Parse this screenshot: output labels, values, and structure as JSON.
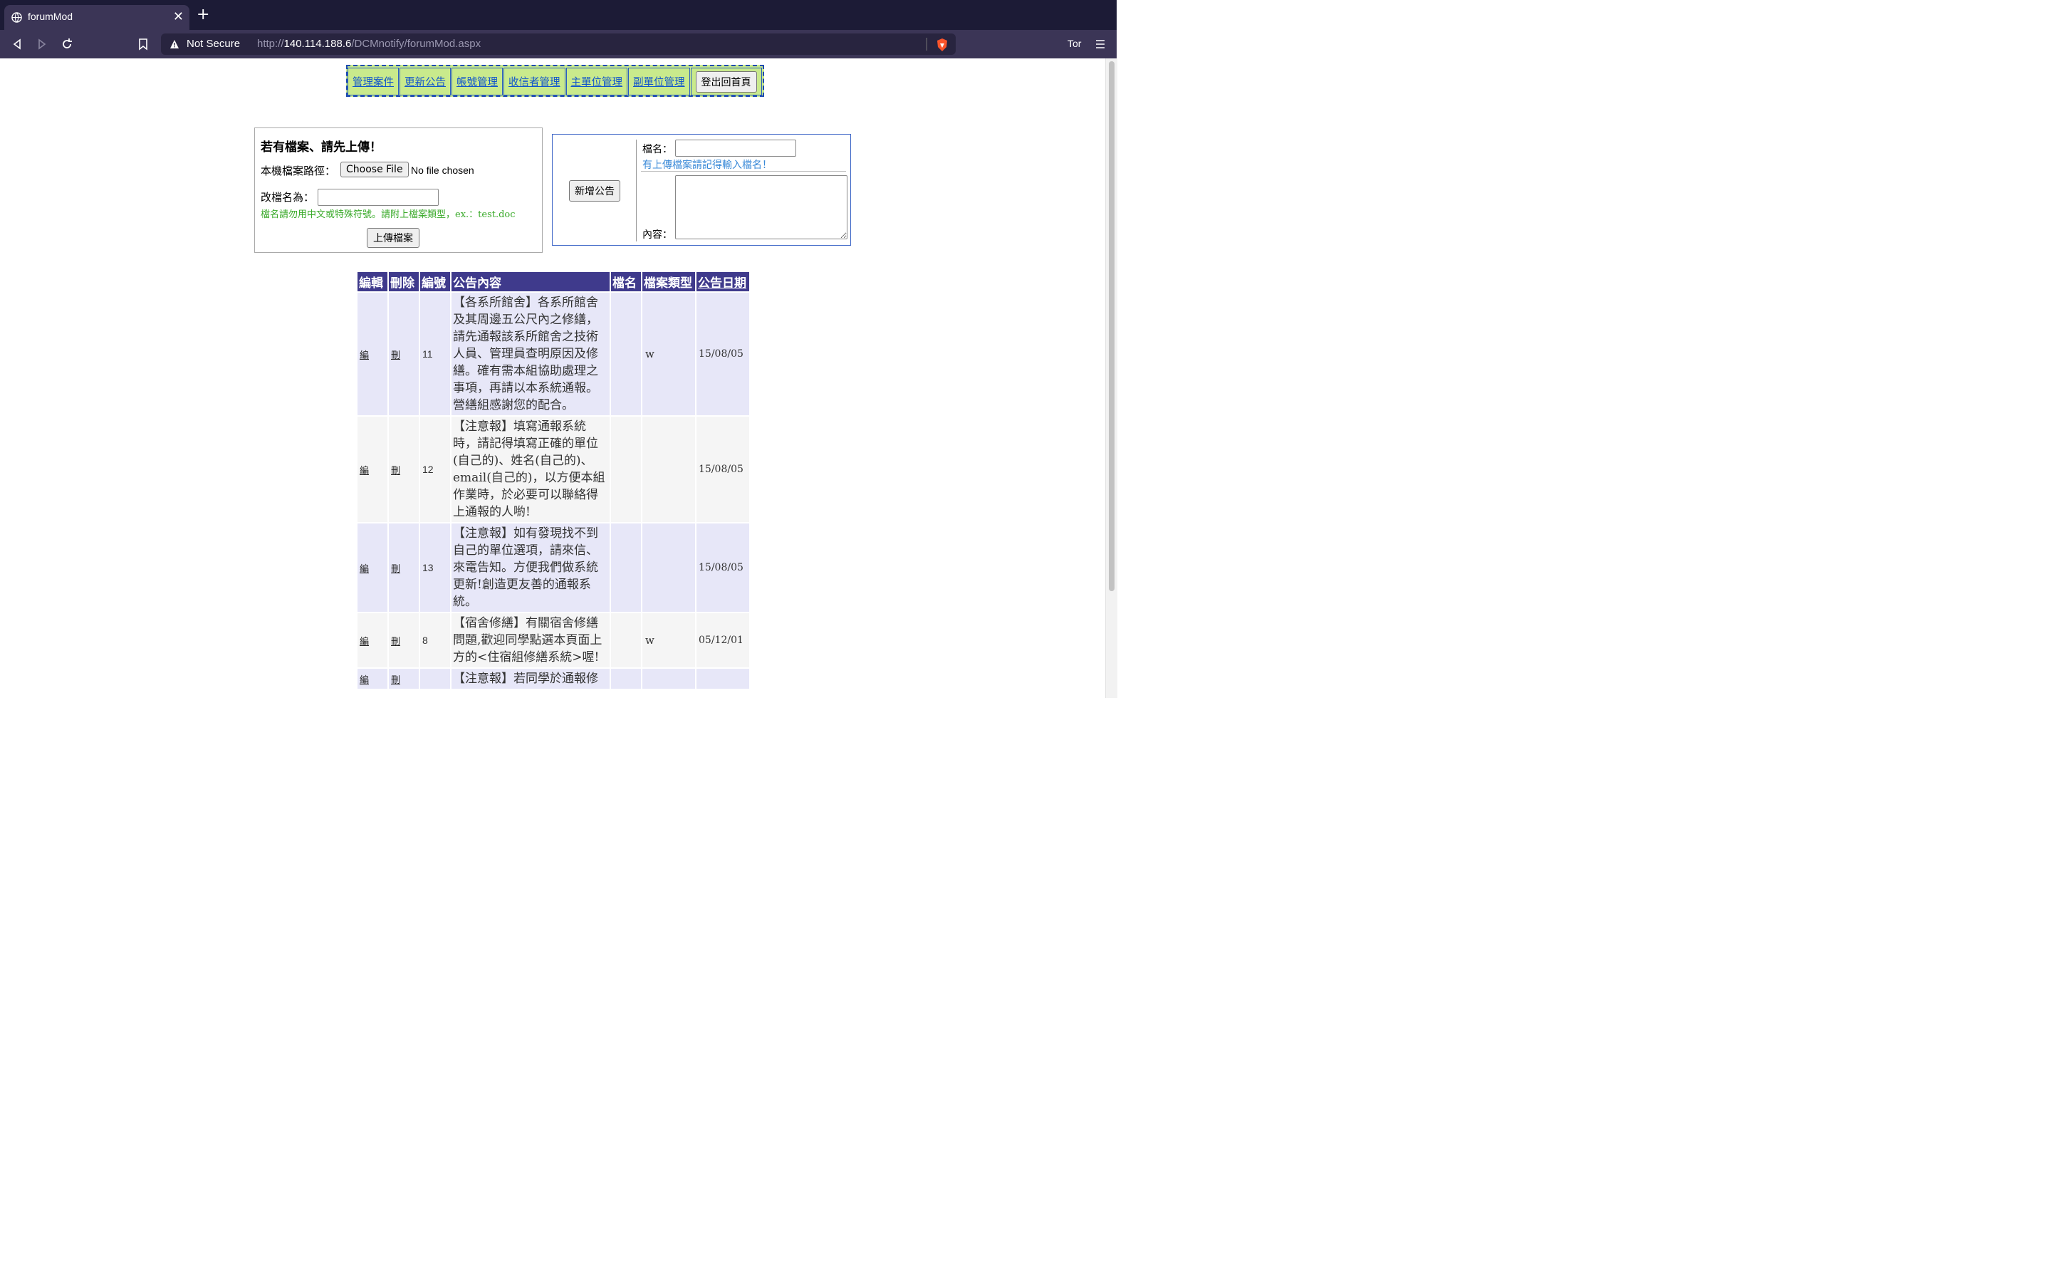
{
  "browser": {
    "tab_title": "forumMod",
    "security_label": "Not Secure",
    "url_scheme": "http://",
    "url_host": "140.114.188.6",
    "url_path": "/DCMnotify/forumMod.aspx",
    "profile_label": "Tor"
  },
  "nav": {
    "items": [
      "管理案件",
      "更新公告",
      "帳號管理",
      "收信者管理",
      "主單位管理",
      "副單位管理"
    ],
    "logout_label": "登出回首頁"
  },
  "upload": {
    "heading": "若有檔案、請先上傳！",
    "path_label": "本機檔案路徑：",
    "choose_button": "Choose File",
    "no_file_text": "No file chosen",
    "rename_label": "改檔名為：",
    "rename_value": "",
    "hint": "檔名請勿用中文或特殊符號。請附上檔案類型，ex.：test.doc",
    "upload_button": "上傳檔案"
  },
  "announce": {
    "add_button": "新增公告",
    "filename_label": "檔名：",
    "filename_value": "",
    "filename_hint": "有上傳檔案請記得輸入檔名！",
    "content_label": "內容：",
    "content_value": ""
  },
  "table": {
    "headers": [
      "編輯",
      "刪除",
      "編號",
      "公告內容",
      "檔名",
      "檔案類型",
      "公告日期"
    ],
    "rows": [
      {
        "edit": "編",
        "del": "刪",
        "id": "11",
        "content": "【各系所館舍】各系所館舍及其周邊五公尺內之修繕，請先通報該系所館舍之技術人員、管理員查明原因及修繕。確有需本組協助處理之事項，再請以本系統通報。營繕組感謝您的配合。",
        "filename": "",
        "filetype": "w",
        "date": "15/08/05"
      },
      {
        "edit": "編",
        "del": "刪",
        "id": "12",
        "content": "【注意報】填寫通報系統時，請記得填寫正確的單位(自己的)、姓名(自己的)、email(自己的)，以方便本組作業時，於必要可以聯絡得上通報的人喲!",
        "filename": "",
        "filetype": "",
        "date": "15/08/05"
      },
      {
        "edit": "編",
        "del": "刪",
        "id": "13",
        "content": "【注意報】如有發現找不到自己的單位選項，請來信、來電告知。方便我們做系統更新!創造更友善的通報系統。",
        "filename": "",
        "filetype": "",
        "date": "15/08/05"
      },
      {
        "edit": "編",
        "del": "刪",
        "id": "8",
        "content": "【宿舍修繕】有關宿舍修繕問題,歡迎同學點選本頁面上方的<住宿組修繕系統>喔!",
        "filename": "",
        "filetype": "w",
        "date": "05/12/01"
      },
      {
        "edit": "編",
        "del": "刪",
        "id": "",
        "content": "【注意報】若同學於通報修",
        "filename": "",
        "filetype": "",
        "date": ""
      }
    ]
  }
}
